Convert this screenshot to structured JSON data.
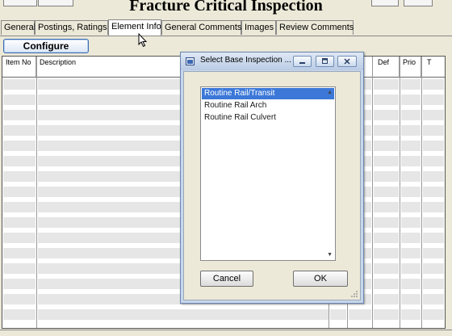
{
  "window": {
    "title": "Fracture Critical Inspection"
  },
  "tabs": [
    {
      "label": "General",
      "active": false
    },
    {
      "label": "Postings, Ratings",
      "active": false
    },
    {
      "label": "Element Info",
      "active": true
    },
    {
      "label": "General Comments",
      "active": false
    },
    {
      "label": "Images",
      "active": false
    },
    {
      "label": "Review Comments",
      "active": false
    }
  ],
  "toolbar": {
    "configure_label": "Configure"
  },
  "grid": {
    "columns": [
      "Item No",
      "Description",
      "Def",
      "Prio",
      "T"
    ]
  },
  "dialog": {
    "title": "Select Base Inspection ...",
    "items": [
      {
        "label": "Routine Rail/Transit",
        "selected": true
      },
      {
        "label": "Routine Rail Arch",
        "selected": false
      },
      {
        "label": "Routine Rail Culvert",
        "selected": false
      }
    ],
    "cancel_label": "Cancel",
    "ok_label": "OK"
  },
  "colors": {
    "selection": "#3b78d8",
    "accent": "#3b6bb1"
  },
  "icons": [
    "app-icon",
    "minimize-icon",
    "maximize-icon",
    "close-icon",
    "resize-grip-icon",
    "mouse-pointer-icon"
  ]
}
